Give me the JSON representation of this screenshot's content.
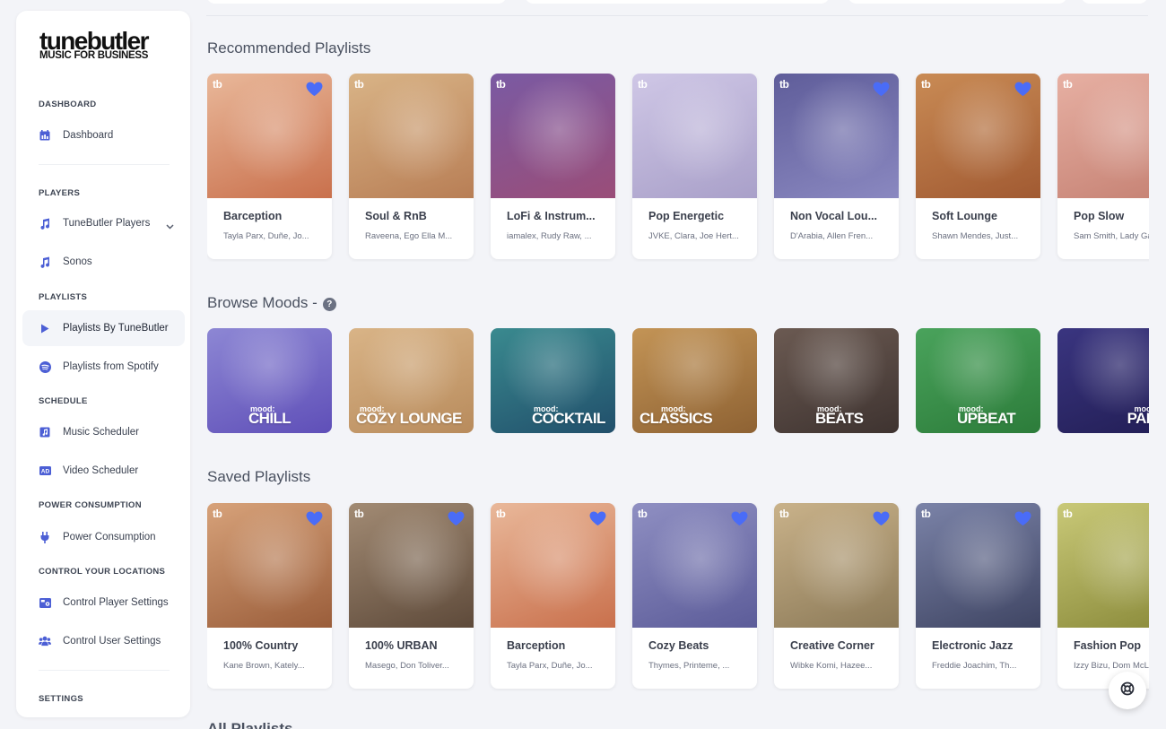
{
  "brand": {
    "name": "tunebutler",
    "tagline": "MUSIC FOR BUSINESS"
  },
  "sidebar": {
    "sections": {
      "dashboard": "DASHBOARD",
      "players": "PLAYERS",
      "playlists": "PLAYLISTS",
      "schedule": "SCHEDULE",
      "power": "POWER CONSUMPTION",
      "control": "CONTROL YOUR LOCATIONS",
      "settings": "SETTINGS"
    },
    "items": {
      "dashboard": "Dashboard",
      "tunebutler_players": "TuneButler Players",
      "sonos": "Sonos",
      "playlists_by_tunebutler": "Playlists By TuneButler",
      "playlists_from_spotify": "Playlists from Spotify",
      "music_scheduler": "Music Scheduler",
      "video_scheduler": "Video Scheduler",
      "power_consumption": "Power Consumption",
      "control_player_settings": "Control Player Settings",
      "control_user_settings": "Control User Settings"
    },
    "active": "playlists_by_tunebutler"
  },
  "main": {
    "recommended_title": "Recommended Playlists",
    "moods_title": "Browse Moods -",
    "saved_title": "Saved Playlists",
    "all_title": "All Playlists",
    "card_badge": "tb",
    "recommended": [
      {
        "name": "Barception",
        "artists": "Tayla Parx, Duñe, Jo...",
        "liked": true,
        "colors": [
          "#e9b89a",
          "#c9704c"
        ]
      },
      {
        "name": "Soul & RnB",
        "artists": "Raveena, Ego Ella M...",
        "liked": false,
        "colors": [
          "#d9b487",
          "#b87e55"
        ]
      },
      {
        "name": "LoFi & Instrum...",
        "artists": "iamalex, Rudy Raw, ...",
        "liked": false,
        "colors": [
          "#7a5aa3",
          "#9a4d78"
        ]
      },
      {
        "name": "Pop Energetic",
        "artists": "JVKE, Clara, Joe Hert...",
        "liked": false,
        "colors": [
          "#cfc7e6",
          "#a9a0c9"
        ]
      },
      {
        "name": "Non Vocal Lou...",
        "artists": "D'Arabia, Allen Fren...",
        "liked": true,
        "colors": [
          "#5f5d9a",
          "#8a88c0"
        ]
      },
      {
        "name": "Soft Lounge",
        "artists": "Shawn Mendes, Just...",
        "liked": true,
        "colors": [
          "#c98b55",
          "#a15a32"
        ]
      },
      {
        "name": "Pop Slow",
        "artists": "Sam Smith, Lady Ga...",
        "liked": false,
        "colors": [
          "#e7b0a3",
          "#c58173"
        ]
      }
    ],
    "moods": [
      {
        "prefix": "mood:",
        "label": "CHILL",
        "colors": [
          "#8d87d4",
          "#5f4fb8"
        ]
      },
      {
        "prefix": "mood:",
        "label": "COZY LOUNGE",
        "colors": [
          "#d9b487",
          "#b88b5c"
        ]
      },
      {
        "prefix": "mood:",
        "label": "COCKTAIL",
        "colors": [
          "#3a8a8f",
          "#214f6b"
        ]
      },
      {
        "prefix": "mood:",
        "label": "CLASSICS",
        "colors": [
          "#c39456",
          "#8e6233"
        ]
      },
      {
        "prefix": "mood:",
        "label": "BEATS",
        "colors": [
          "#6b5a52",
          "#3e3330"
        ]
      },
      {
        "prefix": "mood:",
        "label": "UPBEAT",
        "colors": [
          "#4aa35c",
          "#2c7c3a"
        ]
      },
      {
        "prefix": "mood:",
        "label": "PARTY",
        "colors": [
          "#3a3580",
          "#221e55"
        ]
      }
    ],
    "saved": [
      {
        "name": "100% Country",
        "artists": "Kane Brown, Kately...",
        "liked": true,
        "colors": [
          "#d7a27a",
          "#9a5d3a"
        ]
      },
      {
        "name": "100% URBAN",
        "artists": "Masego, Don Toliver...",
        "liked": true,
        "colors": [
          "#a28b74",
          "#5e4a3a"
        ]
      },
      {
        "name": "Barception",
        "artists": "Tayla Parx, Duñe, Jo...",
        "liked": true,
        "colors": [
          "#e9b89a",
          "#c9704c"
        ]
      },
      {
        "name": "Cozy Beats",
        "artists": "Thymes, Printeme, ...",
        "liked": true,
        "colors": [
          "#8f8fc2",
          "#5c5c99"
        ]
      },
      {
        "name": "Creative Corner",
        "artists": "Wibke Komi, Hazee...",
        "liked": true,
        "colors": [
          "#c9b28a",
          "#8c7a58"
        ]
      },
      {
        "name": "Electronic Jazz",
        "artists": "Freddie Joachim, Th...",
        "liked": true,
        "colors": [
          "#7b83a8",
          "#3f4563"
        ]
      },
      {
        "name": "Fashion Pop",
        "artists": "Izzy Bizu, Dom McL...",
        "liked": false,
        "colors": [
          "#c9c978",
          "#8a8a3a"
        ]
      }
    ]
  },
  "colors": {
    "accent": "#4a6cf7",
    "sidebar_active": "#f3f5f9",
    "icon": "#4c5fd5"
  },
  "icons": {
    "heart": "heart-icon",
    "support": "lifebuoy-icon",
    "help": "help-circle-icon"
  }
}
